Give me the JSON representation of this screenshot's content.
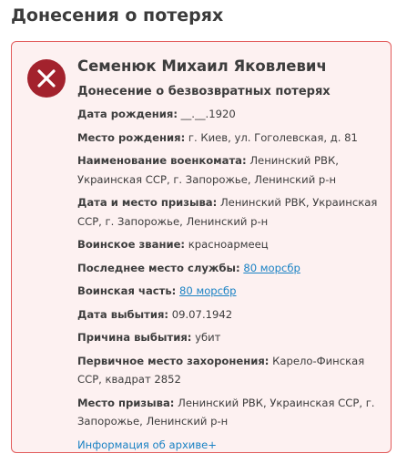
{
  "section_title": "Донесения о потерях",
  "card": {
    "status_icon": "close-x-icon",
    "person_name": "Семенюк Михаил Яковлевич",
    "report_title": "Донесение о безвозвратных потерях",
    "fields": {
      "birth_date": {
        "label": "Дата рождения:",
        "value": " __.__.1920"
      },
      "birth_place": {
        "label": "Место рождения:",
        "value": " г. Киев, ул. Гоголевская, д. 81"
      },
      "commissariat": {
        "label": "Наименование военкомата:",
        "value": " Ленинский РВК, Украинская ССР, г. Запорожье, Ленинский р-н"
      },
      "draft_date_place": {
        "label": "Дата и место призыва:",
        "value": " Ленинский РВК, Украинская ССР, г. Запорожье, Ленинский р-н"
      },
      "rank": {
        "label": "Воинское звание:",
        "value": " красноармеец"
      },
      "last_service_place": {
        "label": "Последнее место службы:",
        "link": "80 морсбр"
      },
      "unit": {
        "label": "Воинская часть:",
        "link": "80 морсбр"
      },
      "retirement_date": {
        "label": "Дата выбытия:",
        "value": " 09.07.1942"
      },
      "retirement_reason": {
        "label": "Причина выбытия:",
        "value": " убит"
      },
      "burial_place": {
        "label": "Первичное место захоронения:",
        "value": " Карело-Финская ССР, квадрат 2852"
      },
      "draft_place": {
        "label": "Место призыва:",
        "value": " Ленинский РВК, Украинская ССР, г. Запорожье, Ленинский р-н"
      }
    },
    "archive_link": "Информация об архиве+"
  },
  "colors": {
    "card_background": "#fdf1f1",
    "card_border": "#e25b5b",
    "status_icon": "#a3222d",
    "link": "#1a82c4"
  }
}
